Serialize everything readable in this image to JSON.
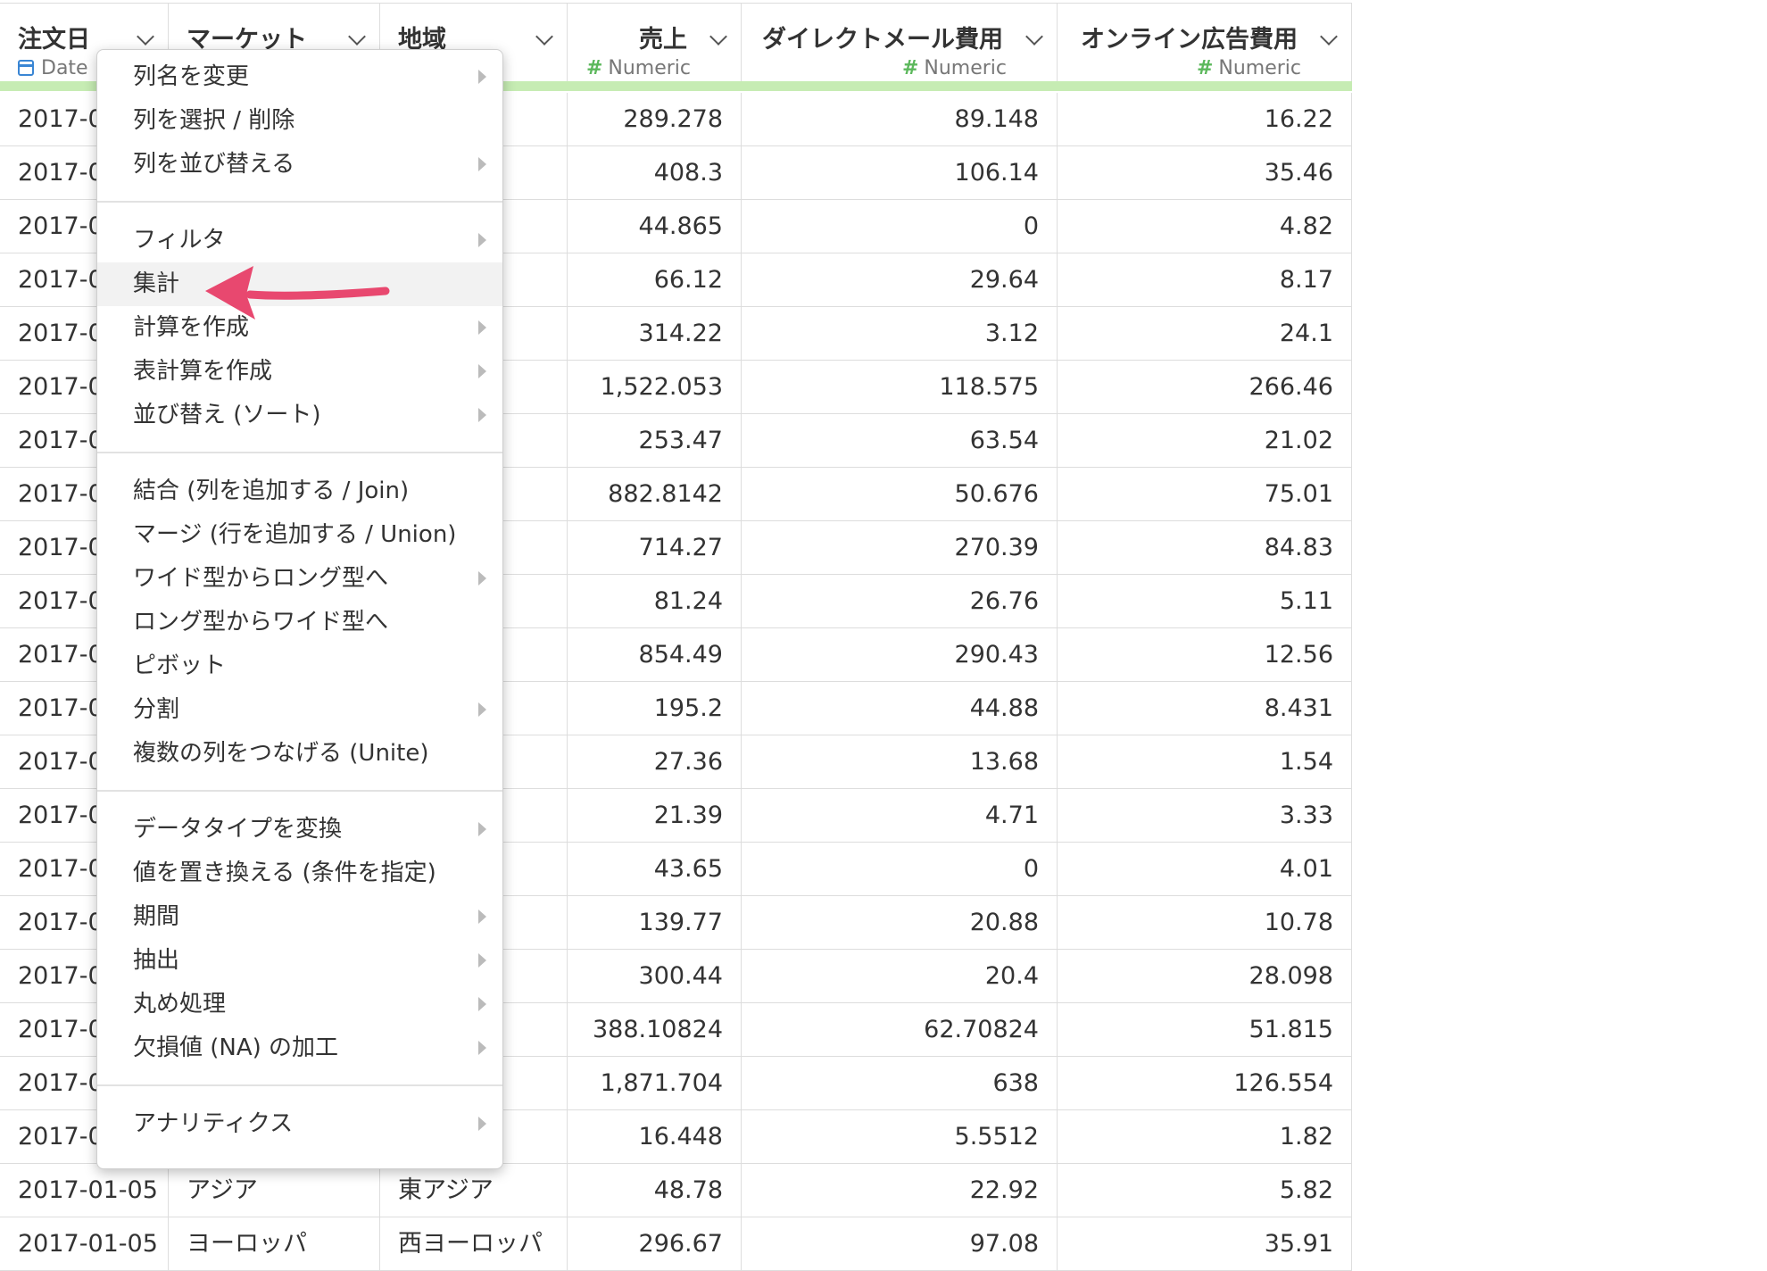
{
  "columns": [
    {
      "name": "注文日",
      "type": "Date",
      "type_icon": "calendar-icon"
    },
    {
      "name": "マーケット",
      "type": "",
      "type_icon": ""
    },
    {
      "name": "地域",
      "type": "r",
      "type_icon": ""
    },
    {
      "name": "売上",
      "type": "Numeric",
      "type_icon": "hash-icon"
    },
    {
      "name": "ダイレクトメール費用",
      "type": "Numeric",
      "type_icon": "hash-icon"
    },
    {
      "name": "オンライン広告費用",
      "type": "Numeric",
      "type_icon": "hash-icon"
    }
  ],
  "rows": [
    [
      "2017-0",
      "",
      "ア",
      "289.278",
      "89.148",
      "16.22"
    ],
    [
      "2017-0",
      "",
      "カ",
      "408.3",
      "106.14",
      "35.46"
    ],
    [
      "2017-0",
      "",
      "ッパ",
      "44.865",
      "0",
      "4.82"
    ],
    [
      "2017-0",
      "",
      "ッパ",
      "66.12",
      "29.64",
      "8.17"
    ],
    [
      "2017-0",
      "",
      "",
      "314.22",
      "3.12",
      "24.1"
    ],
    [
      "2017-0",
      "",
      "ア",
      "1,522.053",
      "118.575",
      "266.46"
    ],
    [
      "2017-0",
      "",
      "",
      "253.47",
      "63.54",
      "21.02"
    ],
    [
      "2017-0",
      "",
      "ア",
      "882.8142",
      "50.676",
      "75.01"
    ],
    [
      "2017-0",
      "",
      "",
      "714.27",
      "270.39",
      "84.83"
    ],
    [
      "2017-0",
      "",
      "カ",
      "81.24",
      "26.76",
      "5.11"
    ],
    [
      "2017-0",
      "",
      "ッパ",
      "854.49",
      "290.43",
      "12.56"
    ],
    [
      "2017-0",
      "",
      "リカ",
      "195.2",
      "44.88",
      "8.431"
    ],
    [
      "2017-0",
      "",
      "",
      "27.36",
      "13.68",
      "1.54"
    ],
    [
      "2017-0",
      "",
      "カ",
      "21.39",
      "4.71",
      "3.33"
    ],
    [
      "2017-0",
      "",
      "ッパ",
      "43.65",
      "0",
      "4.01"
    ],
    [
      "2017-0",
      "",
      "ッパ",
      "139.77",
      "20.88",
      "10.78"
    ],
    [
      "2017-0",
      "",
      "ン",
      "300.44",
      "20.4",
      "28.098"
    ],
    [
      "2017-0",
      "",
      "リカ",
      "388.10824",
      "62.70824",
      "51.815"
    ],
    [
      "2017-0",
      "",
      "カ",
      "1,871.704",
      "638",
      "126.554"
    ],
    [
      "2017-0",
      "",
      "中部",
      "16.448",
      "5.5512",
      "1.82"
    ],
    [
      "2017-01-05",
      "アジア",
      "東アジア",
      "48.78",
      "22.92",
      "5.82"
    ],
    [
      "2017-01-05",
      "ヨーロッパ",
      "西ヨーロッパ",
      "296.67",
      "97.08",
      "35.91"
    ]
  ],
  "menu": {
    "groups": [
      [
        {
          "label": "列名を変更",
          "submenu": true
        },
        {
          "label": "列を選択 / 削除",
          "submenu": false
        },
        {
          "label": "列を並び替える",
          "submenu": true
        }
      ],
      [
        {
          "label": "フィルタ",
          "submenu": true
        },
        {
          "label": "集計",
          "submenu": false,
          "highlighted": true
        },
        {
          "label": "計算を作成",
          "submenu": true
        },
        {
          "label": "表計算を作成",
          "submenu": true
        },
        {
          "label": "並び替え (ソート)",
          "submenu": true
        }
      ],
      [
        {
          "label": "結合 (列を追加する / Join)",
          "submenu": false
        },
        {
          "label": "マージ (行を追加する / Union)",
          "submenu": false
        },
        {
          "label": "ワイド型からロング型へ",
          "submenu": true
        },
        {
          "label": "ロング型からワイド型へ",
          "submenu": false
        },
        {
          "label": "ピボット",
          "submenu": false
        },
        {
          "label": "分割",
          "submenu": true
        },
        {
          "label": "複数の列をつなげる (Unite)",
          "submenu": false
        }
      ],
      [
        {
          "label": "データタイプを変換",
          "submenu": true
        },
        {
          "label": "値を置き換える (条件を指定)",
          "submenu": false
        },
        {
          "label": "期間",
          "submenu": true
        },
        {
          "label": "抽出",
          "submenu": true
        },
        {
          "label": "丸め処理",
          "submenu": true
        },
        {
          "label": "欠損値 (NA) の加工",
          "submenu": true
        }
      ],
      [
        {
          "label": "アナリティクス",
          "submenu": true
        }
      ]
    ]
  },
  "colors": {
    "accent_arrow": "#e8486f",
    "type_numeric": "#5cb85c",
    "type_date": "#3a86d4",
    "header_bar": "#c6ecb3"
  }
}
